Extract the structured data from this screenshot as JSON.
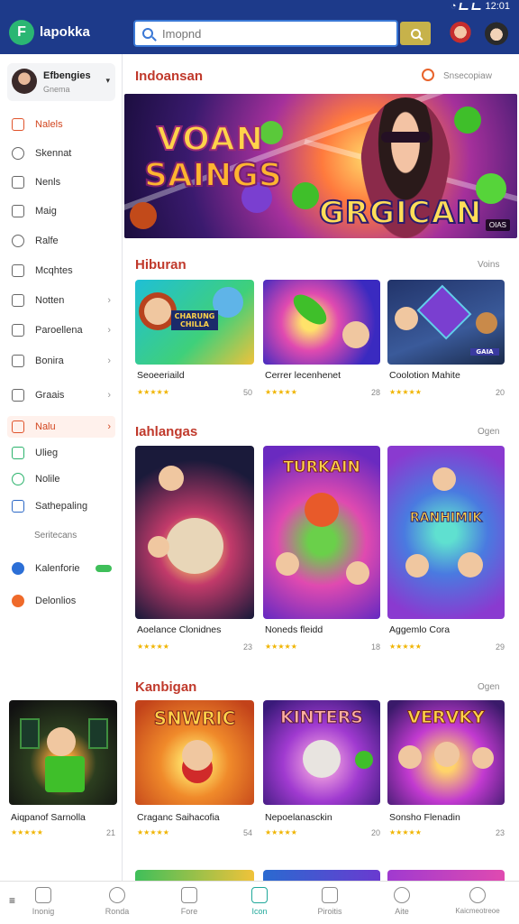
{
  "status_bar": {
    "time": "12:01"
  },
  "header": {
    "app_title": "lapokka",
    "logo_glyph": "F",
    "search_placeholder": "Imopnd",
    "brand_color": "#1d3a8a"
  },
  "sidebar": {
    "profile": {
      "name": "Efbengies",
      "subtitle": "Gnema"
    },
    "items": [
      {
        "label": "Nalels",
        "icon": "briefcase-icon",
        "active": false,
        "color": "red"
      },
      {
        "label": "Skennat",
        "icon": "chat-icon"
      },
      {
        "label": "Nenls",
        "icon": "document-icon"
      },
      {
        "label": "Maig",
        "icon": "mail-icon"
      },
      {
        "label": "Ralfe",
        "icon": "clock-icon"
      },
      {
        "label": "Mcqhtes",
        "icon": "book-icon"
      },
      {
        "label": "Notten",
        "icon": "notebook-icon",
        "chevron": true
      },
      {
        "label": "Paroellena",
        "icon": "calendar-icon",
        "chevron": true
      },
      {
        "label": "Bonira",
        "icon": "card-icon",
        "chevron": true
      },
      {
        "label": "Graais",
        "icon": "controller-icon",
        "chevron": true
      },
      {
        "label": "Nalu",
        "icon": "games-icon",
        "chevron": true,
        "active": true
      },
      {
        "label": "Ulieg",
        "icon": "store-icon",
        "color": "green"
      },
      {
        "label": "Nolile",
        "icon": "refresh-icon",
        "color": "green"
      },
      {
        "label": "Sathepaling",
        "icon": "edit-icon",
        "color": "blue"
      }
    ],
    "section_label": "Seritecans",
    "toggle_item": {
      "label": "Kalenforie"
    },
    "extra_item": {
      "label": "Delonlios"
    },
    "promo_card": {
      "title": "Aiqpanof Sarnolla",
      "stars": "★★★★★",
      "count": "21"
    }
  },
  "main": {
    "featured": {
      "title": "Indoansan",
      "link": "Snsecopiaw",
      "banner": {
        "line1": "VOAN",
        "line2": "SAINGS",
        "line3": "GRGICAN",
        "badge": "OIAS"
      }
    },
    "sections": [
      {
        "title": "Hiburan",
        "link": "Voins",
        "cards": [
          {
            "title": "Seoeeriaild",
            "stars": "★★★★★",
            "count": "50",
            "logo": "CHARUNG CHILLA"
          },
          {
            "title": "Cerrer lecenhenet",
            "stars": "★★★★★",
            "count": "28",
            "logo": ""
          },
          {
            "title": "Coolotion Mahite",
            "stars": "★★★★★",
            "count": "20",
            "logo": "GAIA"
          }
        ]
      },
      {
        "title": "Iahlangas",
        "link": "Ogen",
        "cards": [
          {
            "title": "Aoelance Clonidnes",
            "stars": "★★★★★",
            "count": "23",
            "logo": ""
          },
          {
            "title": "Noneds fleidd",
            "stars": "★★★★★",
            "count": "18",
            "logo": "TURKAIN"
          },
          {
            "title": "Aggemlo Cora",
            "stars": "★★★★★",
            "count": "29",
            "logo": "RANHIMIK"
          }
        ]
      },
      {
        "title": "Kanbigan",
        "link": "Ogen",
        "cards": [
          {
            "title": "Craganc Saihacofia",
            "stars": "★★★★★",
            "count": "54",
            "logo": "SNWRIC"
          },
          {
            "title": "Nepoelanasckin",
            "stars": "★★★★★",
            "count": "20",
            "logo": "KINTERS"
          },
          {
            "title": "Sonsho Flenadin",
            "stars": "★★★★★",
            "count": "23",
            "logo": "VERVKY"
          }
        ]
      }
    ]
  },
  "bottom_nav": [
    {
      "label": "Inonig",
      "icon": "home-icon"
    },
    {
      "label": "Ronda",
      "icon": "leaf-icon"
    },
    {
      "label": "Fore",
      "icon": "bell-icon"
    },
    {
      "label": "Icon",
      "icon": "games-icon",
      "active": true
    },
    {
      "label": "Piroitis",
      "icon": "gift-icon"
    },
    {
      "label": "Aite",
      "icon": "location-icon"
    },
    {
      "label": "Kaicmeotreoe",
      "icon": "user-icon"
    }
  ],
  "colors": {
    "accent": "#1fa89a",
    "section_title": "#c0392b",
    "stars": "#f0b400"
  }
}
